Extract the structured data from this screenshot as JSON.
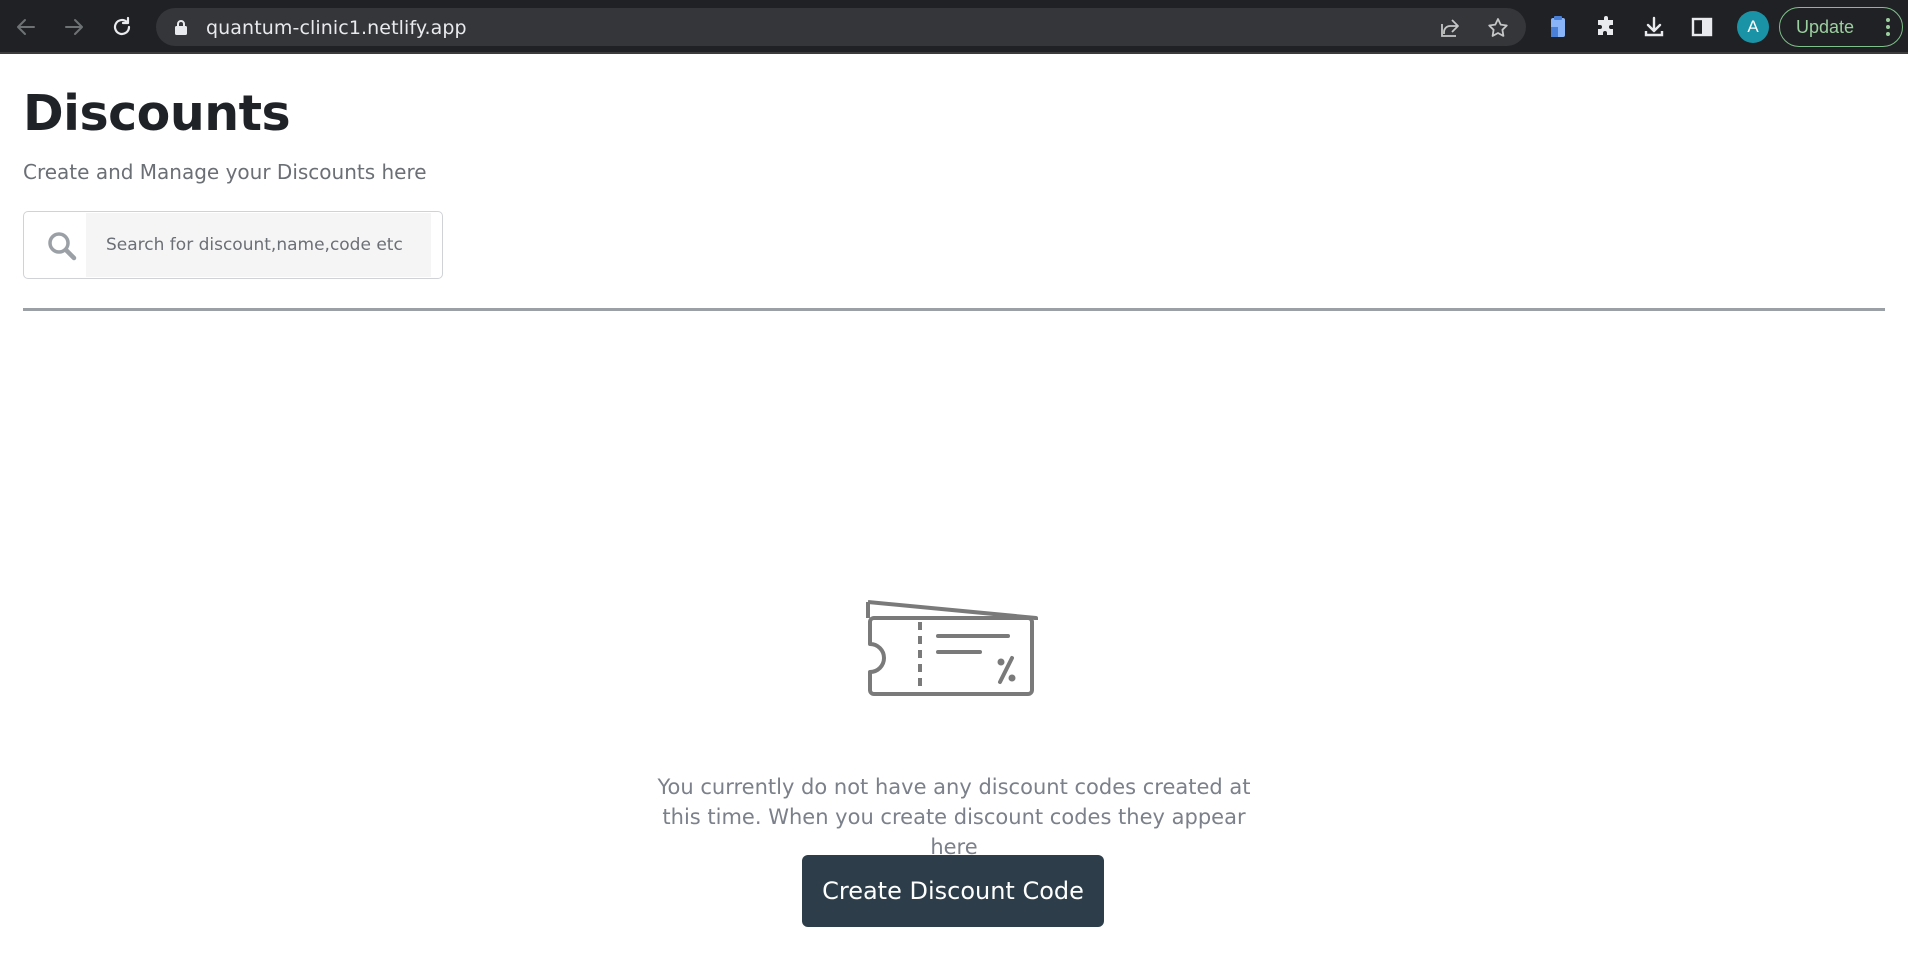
{
  "browser": {
    "url": "quantum-clinic1.netlify.app",
    "avatar_letter": "A",
    "update_label": "Update",
    "icons": [
      "back-arrow-icon",
      "forward-arrow-icon",
      "reload-icon",
      "lock-icon",
      "share-icon",
      "star-icon",
      "clipboard-extension-icon",
      "puzzle-icon",
      "download-icon",
      "sidebar-icon",
      "more-vert-icon"
    ]
  },
  "page": {
    "title": "Discounts",
    "subtitle": "Create and Manage your Discounts here",
    "search": {
      "placeholder": "Search for discount,name,code etc",
      "value": ""
    },
    "empty_state": {
      "icon": "discount-ticket-icon",
      "message": "You currently do not have any discount codes created at this time. When you create discount codes they appear here",
      "button_label": "Create Discount Code"
    }
  },
  "colors": {
    "browser_bg": "#202124",
    "omnibox_bg": "#35363a",
    "avatar": "#1a93a6",
    "update_border": "#7fbf8a",
    "button_bg": "#2d3e4a",
    "muted_text": "#7b808a"
  }
}
